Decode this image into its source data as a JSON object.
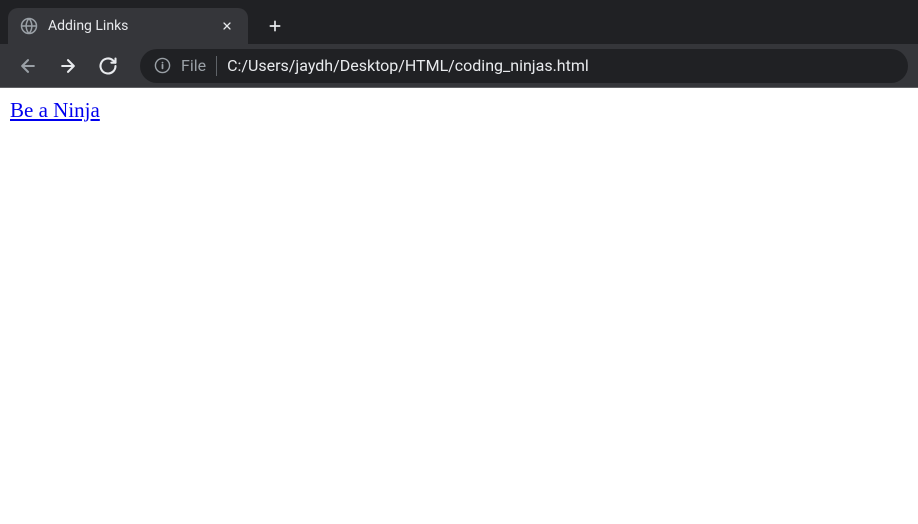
{
  "tab": {
    "title": "Adding Links"
  },
  "address": {
    "protocol_label": "File",
    "url": "C:/Users/jaydh/Desktop/HTML/coding_ninjas.html"
  },
  "page": {
    "link_text": "Be a Ninja"
  }
}
